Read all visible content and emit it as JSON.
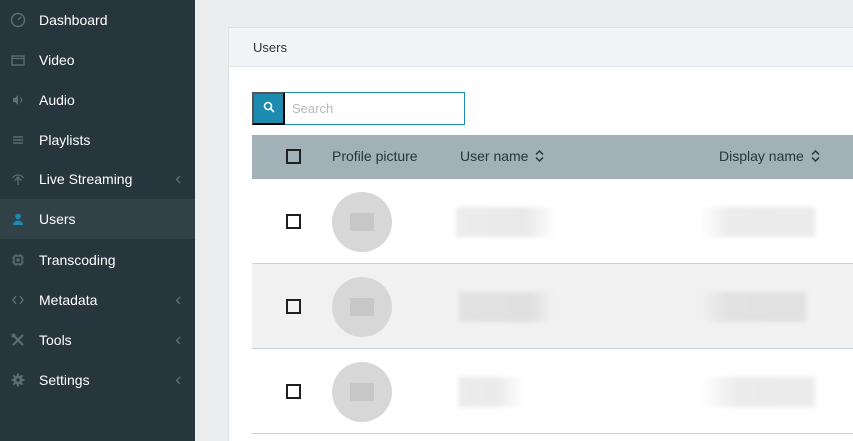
{
  "sidebar": {
    "items": [
      {
        "label": "Dashboard",
        "icon": "gauge-icon",
        "has_chevron": false,
        "active": false
      },
      {
        "label": "Video",
        "icon": "film-icon",
        "has_chevron": false,
        "active": false
      },
      {
        "label": "Audio",
        "icon": "speaker-icon",
        "has_chevron": false,
        "active": false
      },
      {
        "label": "Playlists",
        "icon": "list-icon",
        "has_chevron": false,
        "active": false
      },
      {
        "label": "Live Streaming",
        "icon": "broadcast-icon",
        "has_chevron": true,
        "active": false
      },
      {
        "label": "Users",
        "icon": "user-icon",
        "has_chevron": false,
        "active": true
      },
      {
        "label": "Transcoding",
        "icon": "chip-icon",
        "has_chevron": false,
        "active": false
      },
      {
        "label": "Metadata",
        "icon": "code-brackets-icon",
        "has_chevron": true,
        "active": false
      },
      {
        "label": "Tools",
        "icon": "tools-icon",
        "has_chevron": true,
        "active": false
      },
      {
        "label": "Settings",
        "icon": "gear-icon",
        "has_chevron": true,
        "active": false
      }
    ]
  },
  "card": {
    "title": "Users"
  },
  "search": {
    "placeholder": "Search",
    "value": "",
    "icon": "search-icon"
  },
  "table": {
    "columns": [
      "Profile picture",
      "User name",
      "Display name"
    ],
    "rows": [
      {
        "avatar": "avatar-placeholder-icon"
      },
      {
        "avatar": "avatar-placeholder-icon"
      },
      {
        "avatar": "avatar-placeholder-icon"
      }
    ]
  },
  "colors": {
    "sidebar_bg": "#27363d",
    "sidebar_active": "#324249",
    "accent": "#1d8ab0",
    "table_header": "#a2b1b8",
    "row_alt": "#f1f1f1"
  }
}
